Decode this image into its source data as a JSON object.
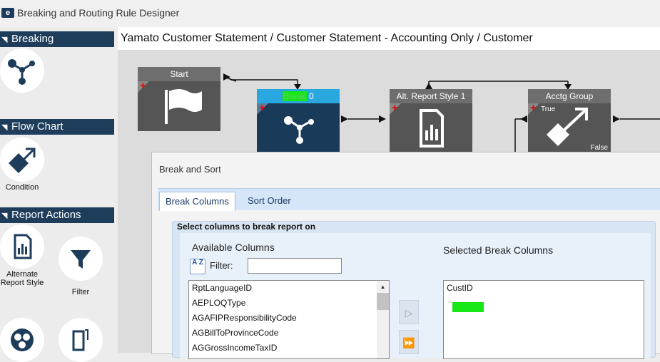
{
  "app": {
    "logo": "e",
    "title": "Breaking and Routing Rule Designer"
  },
  "sidebar": {
    "sections": [
      {
        "title": "Breaking"
      },
      {
        "title": "Flow Chart"
      },
      {
        "title": "Report Actions"
      }
    ],
    "tools": {
      "break": {
        "label": "Break",
        "icon": "branch-icon"
      },
      "condition": {
        "label": "Condition",
        "icon": "diamond-arrow-icon"
      },
      "alternate": {
        "label": "Alternate Report Style",
        "icon": "report-chart-icon"
      },
      "filter": {
        "label": "Filter",
        "icon": "funnel-icon"
      }
    }
  },
  "canvas": {
    "breadcrumb": "Yamato Customer Statement / Customer Statement - Accounting Only / Customer",
    "nodes": {
      "start": "Start",
      "break": "Break",
      "break_count": "0",
      "alt": "Alt. Report Style 1",
      "acctg": "Acctg Group",
      "true_label": "True",
      "false_label": "False"
    }
  },
  "dialog": {
    "title": "Break and Sort",
    "tabs": [
      "Break Columns",
      "Sort Order"
    ],
    "group_title": "Select columns to break report on",
    "available_label": "Available Columns",
    "selected_label": "Selected Break Columns",
    "filter_label": "Filter:",
    "filter_value": "",
    "sort_button": "A Z",
    "available": [
      "RptLanguageID",
      "AEPLOQType",
      "AGAFIPResponsibilityCode",
      "AGBillToProvinceCode",
      "AGGrossIncomeTaxID"
    ],
    "selected": [
      "CustID"
    ],
    "move_one": "▷",
    "move_all": "⏩"
  },
  "colors": {
    "nav": "#1d3d5b",
    "accent": "#29a8e0",
    "highlight": "#17e617"
  }
}
